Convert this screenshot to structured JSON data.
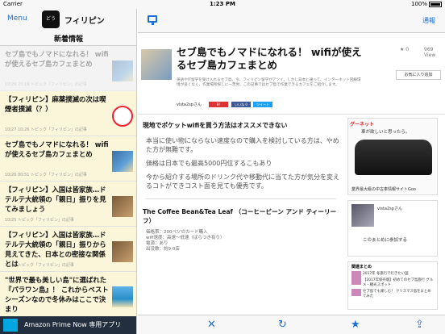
{
  "status": {
    "carrier": "Carrier",
    "time": "1:23 PM",
    "battery": "100%"
  },
  "left": {
    "menu_label": "Menu",
    "logo_text": "どう",
    "site_name": "フィリピン",
    "section_title": "新着情報",
    "items": [
      {
        "title": "セブ島でもノマドになれる！ wifiが使えるセブ島カフェまとめ",
        "meta": "10/29 23:19 トピック「フィリピン」の記事"
      },
      {
        "title": "【フィリピン】麻薬撲滅の次は喫煙者撲滅（？）",
        "meta": "10/27 10:26 トピック「フィリピン」の記事"
      },
      {
        "title": "セブ島でもノマドになれる！ wifiが使えるセブ島カフェまとめ",
        "meta": "10/26 00:51 トピック「フィリピン」の記事"
      },
      {
        "title": "【フィリピン】入国は皆家族…ドテルテ大統領の「親日」振りを見てみましょう",
        "meta": "10/25 トピック「フィリピン」の記事"
      },
      {
        "title": "【フィリピン】入国は皆家族…ドテルテ大統領の「親日」振りから見えてきた、日本との密接な関係とは",
        "meta": "10/24 トピック「フィリピン」の記事"
      },
      {
        "title": "\"世界で最も美しい島\"に選ばれた『パラワン島』！ これからベストシーズンなので冬休みはここで決まり",
        "meta": ""
      }
    ],
    "ad_text": "Amazon Prime Now 専用アプリ"
  },
  "article": {
    "report_label": "通報",
    "title": "セブ島でもノマドになれる！ wifiが使えるセブ島カフェまとめ",
    "description": "英語やIT留学を受け入れるセブ島。今、フィリピン留学がアツイ。しかし日本と違って、インターネット回線環境が良くなく、作業場所探しに一苦労。この記事ではセブ島で作業できるカフェをご紹介します。",
    "stars": "0",
    "views": "969",
    "views_label": "View",
    "fav_label": "お気に入り追加",
    "author": "vista2spさん",
    "share_labels": [
      "B!",
      "いいね 0",
      "ツイート"
    ],
    "section_heading": "現地でポケットwifiを買う方法はオススメできない",
    "quote": [
      "本当に使い物にならない速度なので購入を検討している方は、やめた方が無難です。",
      "価格は日本でも最高5000円位するこもあり",
      "今から紹介する場所のドリンク代や移動代に当てた方が気分を変えるコトができコスト面を見ても優秀です。"
    ],
    "cafe_title": "The Coffee Bean&Tea Leaf （コーヒービーン アンド ティーリーフ）",
    "cafe_specs": [
      "価格帯：200ペソのカード購入",
      "wifi速度：高速〜低速（ばらつき有り）",
      "電源：あり",
      "出没数：約9:0店"
    ]
  },
  "sidebar": {
    "ad_brand": "グーネット",
    "ad_line": "車が欲しいと思ったら。",
    "ad_footer": "業界最大級の中古車情報サイトGoo",
    "profile_name": "vista2spさん",
    "profile_button": "このまとめに参加する",
    "related_heading": "関連まとめ",
    "related": [
      "2017年 冬旅行で行きたい国",
      "【2017年保存版】初めてのセブ島旅行 グルメ・観光スポット",
      "セブ島でも楽しむ！ クリスマス島をまとめてみた"
    ]
  },
  "toolbar": {
    "close_glyph": "✕",
    "reload_glyph": "↻",
    "star_glyph": "★",
    "share_glyph": "⇪"
  }
}
